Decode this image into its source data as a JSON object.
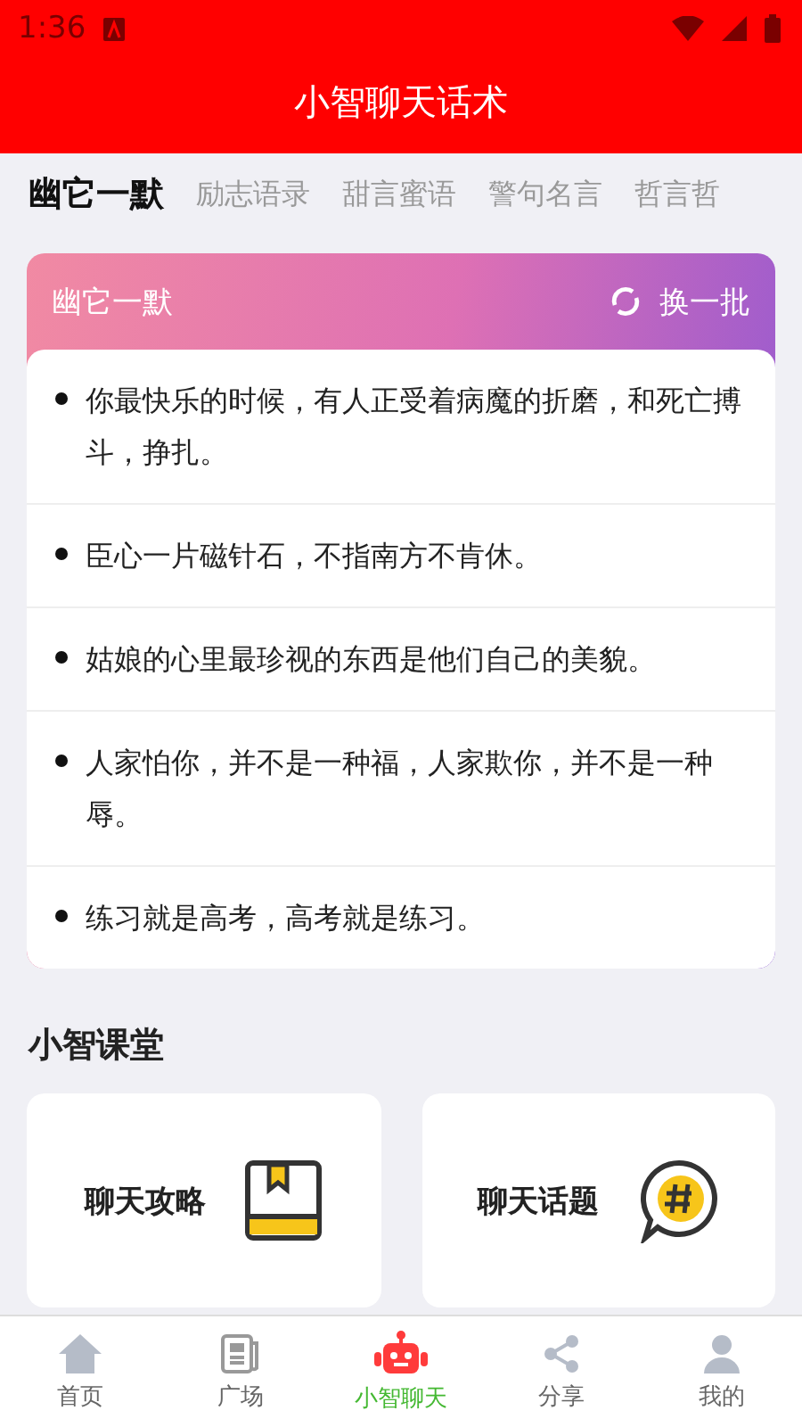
{
  "status_bar": {
    "time": "1:36"
  },
  "app_bar": {
    "title": "小智聊天话术"
  },
  "tabs": [
    {
      "label": "幽它一默",
      "selected": true
    },
    {
      "label": "励志语录",
      "selected": false
    },
    {
      "label": "甜言蜜语",
      "selected": false
    },
    {
      "label": "警句名言",
      "selected": false
    },
    {
      "label": "哲言哲",
      "selected": false
    }
  ],
  "quote_card": {
    "title": "幽它一默",
    "refresh_label": "换一批",
    "quotes": [
      "你最快乐的时候，有人正受着病魔的折磨，和死亡搏斗，挣扎。",
      "臣心一片磁针石，不指南方不肯休。",
      "姑娘的心里最珍视的东西是他们自己的美貌。",
      "人家怕你，并不是一种福，人家欺你，并不是一种辱。",
      "练习就是高考，高考就是练习。"
    ]
  },
  "classroom": {
    "title": "小智课堂",
    "items": [
      {
        "label": "聊天攻略",
        "kind": "book"
      },
      {
        "label": "聊天话题",
        "kind": "topic"
      }
    ]
  },
  "bottom_nav": [
    {
      "label": "首页",
      "kind": "home",
      "selected": false
    },
    {
      "label": "广场",
      "kind": "news",
      "selected": false
    },
    {
      "label": "小智聊天",
      "kind": "robot",
      "selected": true
    },
    {
      "label": "分享",
      "kind": "share",
      "selected": false
    },
    {
      "label": "我的",
      "kind": "user",
      "selected": false
    }
  ]
}
